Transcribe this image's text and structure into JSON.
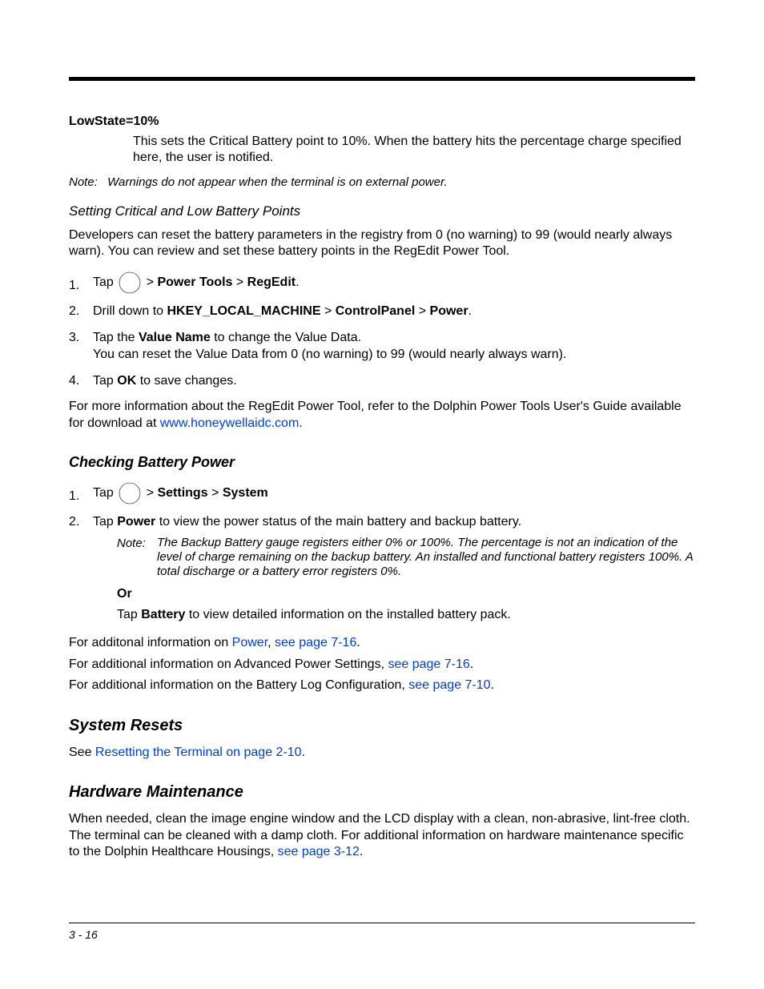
{
  "def": {
    "term": "LowState=10%",
    "body": "This sets the Critical Battery point to 10%. When the battery hits the percentage charge specified here, the user is notified."
  },
  "note1": {
    "label": "Note:",
    "text": "Warnings do not appear when the terminal is on external power."
  },
  "section_setting": {
    "heading": "Setting Critical and Low Battery Points",
    "intro": "Developers can reset the battery parameters in the registry from 0 (no warning) to 99 (would nearly always warn). You can review and set these battery points in the RegEdit Power Tool.",
    "step1": {
      "pre": "Tap ",
      "sep1": " > ",
      "b1": "Power Tools",
      "sep2": " > ",
      "b2": "RegEdit",
      "end": "."
    },
    "step2": {
      "pre": "Drill down to ",
      "b1": "HKEY_LOCAL_MACHINE",
      "sep1": " > ",
      "b2": "ControlPanel",
      "sep2": " > ",
      "b3": "Power",
      "end": "."
    },
    "step3": {
      "pre": "Tap the ",
      "b1": "Value Name",
      "mid": " to change the Value Data.",
      "line2": "You can reset the Value Data from 0 (no warning) to 99 (would nearly always warn)."
    },
    "step4": {
      "pre": "Tap ",
      "b1": "OK",
      "end": " to save changes."
    },
    "more": {
      "pre": "For more information about the RegEdit Power Tool, refer to the Dolphin Power Tools User's Guide available for download at ",
      "link": "www.honeywellaidc.com",
      "end": "."
    }
  },
  "section_checking": {
    "heading": "Checking Battery Power",
    "step1": {
      "pre": "Tap ",
      "sep1": " > ",
      "b1": "Settings",
      "sep2": " > ",
      "b2": "System"
    },
    "step2": {
      "pre": "Tap ",
      "b1": "Power",
      "end": " to view the power status of the main battery and backup battery."
    },
    "note": {
      "label": "Note:",
      "text": "The Backup Battery gauge registers either 0% or 100%. The percentage is not an indication of the level of charge remaining on the backup battery. An installed and functional battery registers 100%. A total discharge or a battery error registers 0%."
    },
    "or": {
      "label": "Or",
      "pre": "Tap ",
      "b1": "Battery",
      "end": " to view detailed information on the installed battery pack."
    },
    "p1": {
      "pre": "For additonal information on ",
      "link1": "Power",
      "mid": ", ",
      "link2": "see page 7-16",
      "end": "."
    },
    "p2": {
      "pre": "For additional information on Advanced Power Settings, ",
      "link": "see page 7-16",
      "end": "."
    },
    "p3": {
      "pre": "For additional information on the Battery Log Configuration, ",
      "link": "see page 7-10",
      "end": "."
    }
  },
  "section_resets": {
    "heading": "System Resets",
    "p": {
      "pre": "See ",
      "link": "Resetting the Terminal on page 2-10",
      "end": "."
    }
  },
  "section_hw": {
    "heading": "Hardware Maintenance",
    "p": {
      "pre": "When needed, clean the image engine window and the LCD display with a clean, non-abrasive, lint-free cloth. The terminal can be cleaned with a damp cloth. For additional information on hardware maintenance specific to the Dolphin Healthcare Housings, ",
      "link": "see page 3-12",
      "end": "."
    }
  },
  "footer": {
    "page": "3 - 16"
  }
}
